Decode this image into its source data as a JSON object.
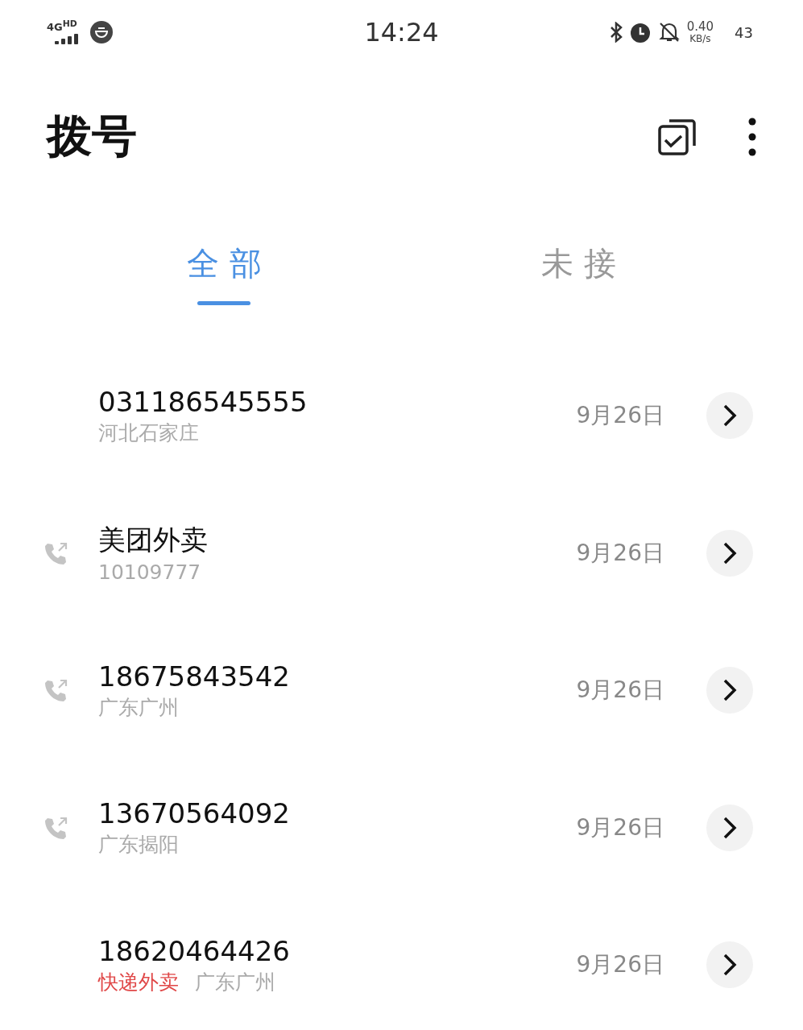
{
  "status_bar": {
    "network": "4G",
    "network_sub": "HD",
    "time": "14:24",
    "speed": "0.40",
    "speed_unit": "KB/s",
    "battery": "43"
  },
  "header": {
    "title": "拨号"
  },
  "tabs": [
    {
      "label": "全 部",
      "selected": true
    },
    {
      "label": "未 接",
      "selected": false
    }
  ],
  "calls": [
    {
      "name": "031186545555",
      "outgoing": false,
      "detail": "河北石家庄",
      "date": "9月26日"
    },
    {
      "name": "美团外卖",
      "outgoing": true,
      "detail": "10109777",
      "date": "9月26日"
    },
    {
      "name": "18675843542",
      "outgoing": true,
      "detail": "广东广州",
      "date": "9月26日"
    },
    {
      "name": "13670564092",
      "outgoing": true,
      "detail": "广东揭阳",
      "date": "9月26日"
    },
    {
      "name": "18620464426",
      "outgoing": false,
      "tag": "快递外卖",
      "detail": "广东广州",
      "date": "9月26日"
    }
  ]
}
